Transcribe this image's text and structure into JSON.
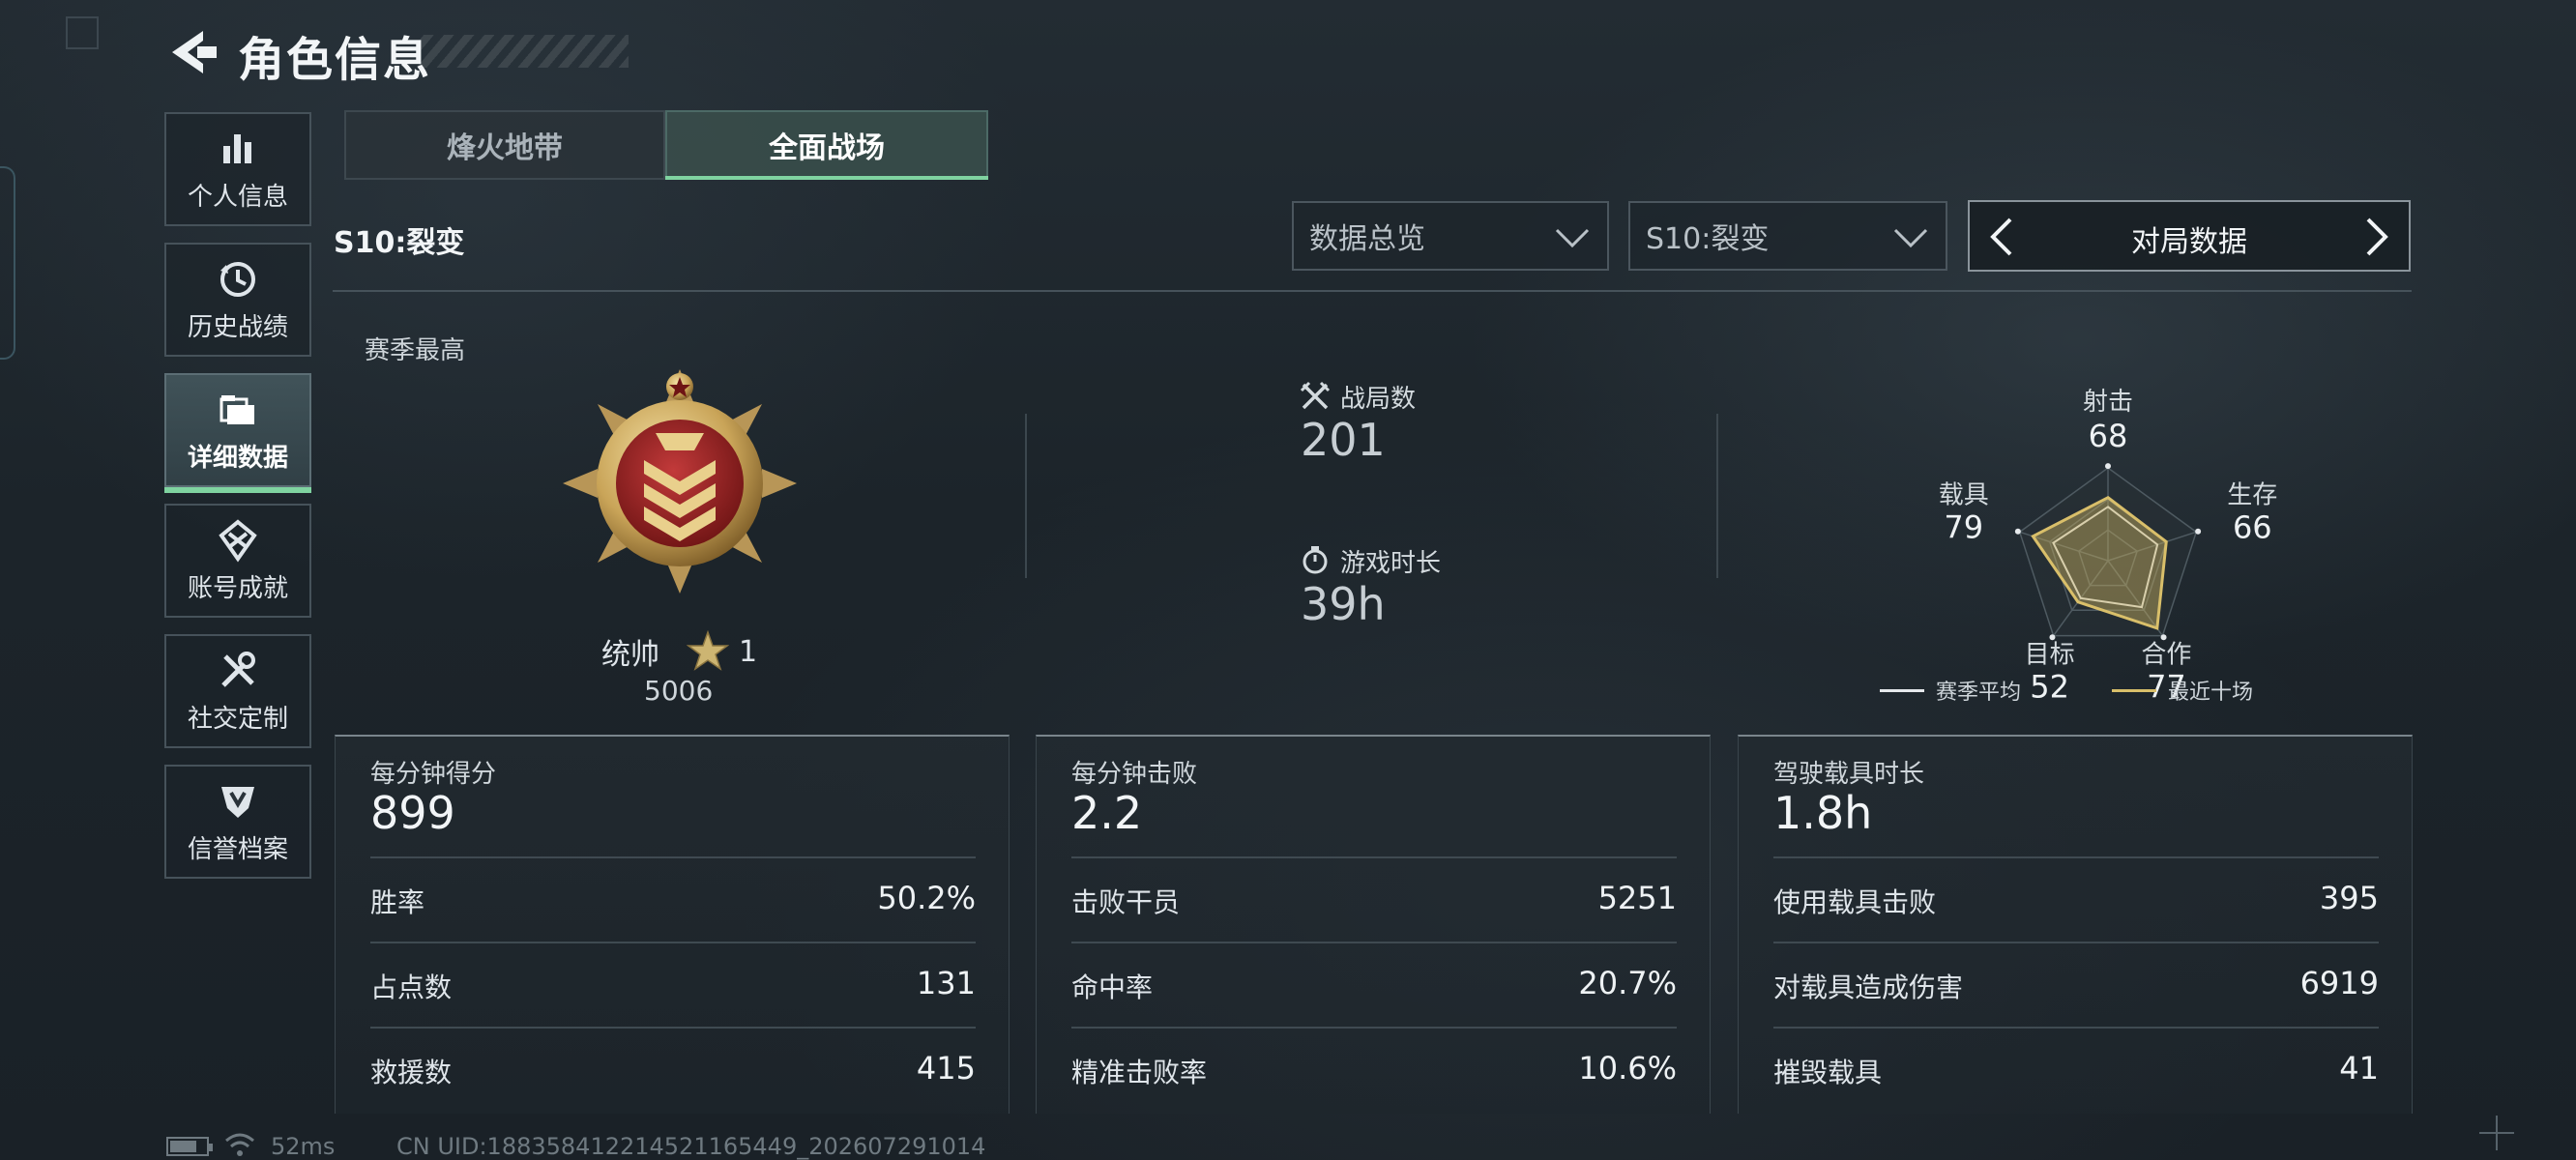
{
  "header": {
    "title": "角色信息"
  },
  "sidebar": {
    "items": [
      {
        "label": "个人信息",
        "icon": "bar-chart-icon"
      },
      {
        "label": "历史战绩",
        "icon": "history-clock-icon"
      },
      {
        "label": "详细数据",
        "icon": "cards-icon",
        "active": true
      },
      {
        "label": "账号成就",
        "icon": "achievement-icon"
      },
      {
        "label": "社交定制",
        "icon": "tools-icon"
      },
      {
        "label": "信誉档案",
        "icon": "shield-icon"
      }
    ]
  },
  "mode_tabs": [
    {
      "label": "烽火地带",
      "active": false
    },
    {
      "label": "全面战场",
      "active": true
    }
  ],
  "season": {
    "label": "S10:裂变"
  },
  "filters": {
    "overview": "数据总览",
    "season_select": "S10:裂变",
    "pager_label": "对局数据"
  },
  "best": {
    "label": "赛季最高",
    "rank_name": "统帅",
    "stars": "1",
    "score": "5006"
  },
  "stats": {
    "matches": {
      "label": "战局数",
      "value": "201",
      "icon": "crossed-swords-icon"
    },
    "playtime": {
      "label": "游戏时长",
      "value": "39h",
      "icon": "stopwatch-icon"
    }
  },
  "radar": {
    "axes": [
      {
        "label": "射击",
        "value": "68",
        "season_avg": 0.58,
        "recent": 0.68
      },
      {
        "label": "生存",
        "value": "66",
        "season_avg": 0.56,
        "recent": 0.66
      },
      {
        "label": "合作",
        "value": "77",
        "season_avg": 0.62,
        "recent": 0.9
      },
      {
        "label": "目标",
        "value": "52",
        "season_avg": 0.5,
        "recent": 0.55
      },
      {
        "label": "载具",
        "value": "79",
        "season_avg": 0.62,
        "recent": 0.85
      }
    ],
    "legend": {
      "season_avg": "赛季平均",
      "recent": "最近十场"
    },
    "colors": {
      "season_avg": "#e6e9ec",
      "recent": "#d9bf6a"
    }
  },
  "cards": [
    {
      "label": "每分钟得分",
      "value": "899",
      "rows": [
        {
          "label": "胜率",
          "value": "50.2%"
        },
        {
          "label": "占点数",
          "value": "131"
        },
        {
          "label": "救援数",
          "value": "415"
        }
      ]
    },
    {
      "label": "每分钟击败",
      "value": "2.2",
      "rows": [
        {
          "label": "击败干员",
          "value": "5251"
        },
        {
          "label": "命中率",
          "value": "20.7%"
        },
        {
          "label": "精准击败率",
          "value": "10.6%"
        }
      ]
    },
    {
      "label": "驾驶载具时长",
      "value": "1.8h",
      "rows": [
        {
          "label": "使用载具击败",
          "value": "395"
        },
        {
          "label": "对载具造成伤害",
          "value": "6919"
        },
        {
          "label": "摧毁载具",
          "value": "41"
        }
      ]
    }
  ],
  "status_bar": {
    "ping": "52ms",
    "uid": "CN UID:188358412214521165449_202607291014",
    "battery_level": 0.75
  },
  "colors": {
    "accent": "#7fd3a0",
    "gold": "#d9bf6a"
  }
}
